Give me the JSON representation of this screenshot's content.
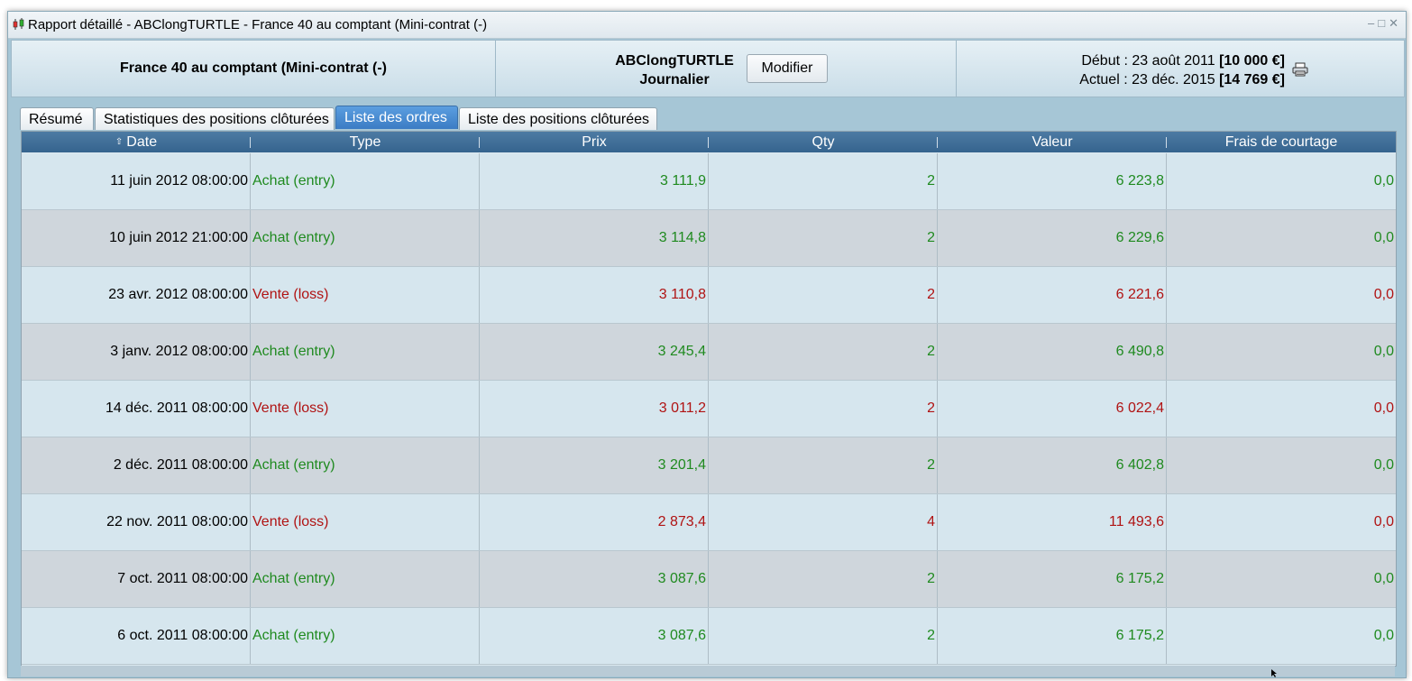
{
  "window": {
    "title": "Rapport détaillé - ABClongTURTLE - France 40 au comptant (Mini-contrat  (-)",
    "controls": [
      "–",
      "□",
      "✕"
    ]
  },
  "header": {
    "instrument": "France 40 au comptant (Mini-contrat  (-)",
    "strategy_name": "ABClongTURTLE",
    "timeframe": "Journalier",
    "modify_label": "Modifier",
    "start_label": "Début : 23 août 2011",
    "start_value": "[10 000 €]",
    "current_label": "Actuel : 23 déc. 2015",
    "current_value": "[14 769 €]"
  },
  "tabs": [
    {
      "label": "Résumé",
      "active": false
    },
    {
      "label": "Statistiques des positions clôturées",
      "active": false
    },
    {
      "label": "Liste des ordres",
      "active": true
    },
    {
      "label": "Liste des positions clôturées",
      "active": false
    }
  ],
  "table": {
    "columns": [
      "Date",
      "Type",
      "Prix",
      "Qty",
      "Valeur",
      "Frais de courtage"
    ],
    "sort_column": "Date",
    "rows": [
      {
        "date": "11 juin 2012 08:00:00",
        "type": "Achat (entry)",
        "price": "3 111,9",
        "qty": "2",
        "value": "6 223,8",
        "fees": "0,0",
        "side": "buy"
      },
      {
        "date": "10 juin 2012 21:00:00",
        "type": "Achat (entry)",
        "price": "3 114,8",
        "qty": "2",
        "value": "6 229,6",
        "fees": "0,0",
        "side": "buy"
      },
      {
        "date": "23 avr. 2012 08:00:00",
        "type": "Vente (loss)",
        "price": "3 110,8",
        "qty": "2",
        "value": "6 221,6",
        "fees": "0,0",
        "side": "sell"
      },
      {
        "date": "3 janv. 2012 08:00:00",
        "type": "Achat (entry)",
        "price": "3 245,4",
        "qty": "2",
        "value": "6 490,8",
        "fees": "0,0",
        "side": "buy"
      },
      {
        "date": "14 déc. 2011 08:00:00",
        "type": "Vente (loss)",
        "price": "3 011,2",
        "qty": "2",
        "value": "6 022,4",
        "fees": "0,0",
        "side": "sell"
      },
      {
        "date": "2 déc. 2011 08:00:00",
        "type": "Achat (entry)",
        "price": "3 201,4",
        "qty": "2",
        "value": "6 402,8",
        "fees": "0,0",
        "side": "buy"
      },
      {
        "date": "22 nov. 2011 08:00:00",
        "type": "Vente (loss)",
        "price": "2 873,4",
        "qty": "4",
        "value": "11 493,6",
        "fees": "0,0",
        "side": "sell"
      },
      {
        "date": "7 oct. 2011 08:00:00",
        "type": "Achat (entry)",
        "price": "3 087,6",
        "qty": "2",
        "value": "6 175,2",
        "fees": "0,0",
        "side": "buy"
      },
      {
        "date": "6 oct. 2011 08:00:00",
        "type": "Achat (entry)",
        "price": "3 087,6",
        "qty": "2",
        "value": "6 175,2",
        "fees": "0,0",
        "side": "buy"
      }
    ]
  },
  "colors": {
    "buy": "#1f8a1f",
    "sell": "#b01313",
    "tab_active": "#4a8cd2",
    "header_bg": "#3f6d96"
  },
  "icons": [
    "app-candlestick-icon",
    "printer-icon",
    "sort-asc-icon"
  ]
}
